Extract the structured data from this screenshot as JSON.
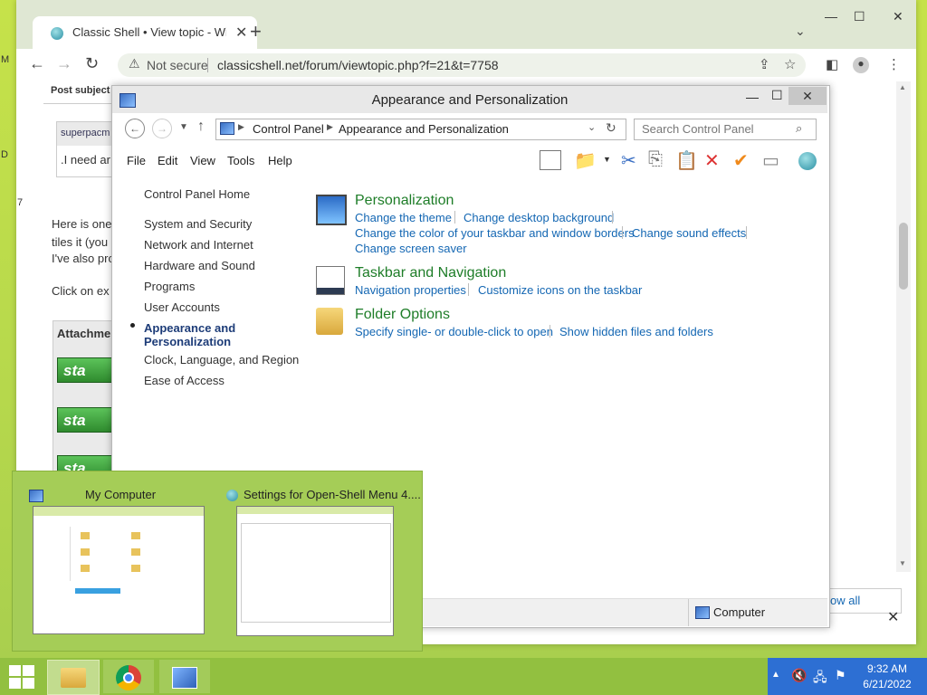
{
  "browser": {
    "tab_title": "Classic Shell • View topic - Windo",
    "new_tab": "+",
    "close_tab": "✕",
    "not_secure": "Not secure",
    "url": "classicshell.net/forum/viewtopic.php?f=21&t=7758"
  },
  "forum": {
    "post_subject": "Post subject",
    "user": "superpacm",
    "quote": ".I need ar",
    "line1": "Here is one",
    "line2": "tiles it (you",
    "line3": "I've also pro",
    "line4": "Click on ex",
    "attachments": "Attachme",
    "start_text": "sta",
    "num": "7",
    "left_m": "M",
    "left_d": "D",
    "show_all": "ow all"
  },
  "control_panel": {
    "title": "Appearance and Personalization",
    "breadcrumb": [
      "Control Panel",
      "Appearance and Personalization"
    ],
    "search_placeholder": "Search Control Panel",
    "menu": [
      "File",
      "Edit",
      "View",
      "Tools",
      "Help"
    ],
    "left_nav": {
      "home": "Control Panel Home",
      "items": [
        "System and Security",
        "Network and Internet",
        "Hardware and Sound",
        "Programs",
        "User Accounts"
      ],
      "current_line1": "Appearance and",
      "current_line2": "Personalization",
      "items2": [
        "Clock, Language, and Region",
        "Ease of Access"
      ]
    },
    "categories": {
      "personalization": {
        "title": "Personalization",
        "links": [
          "Change the theme",
          "Change desktop background",
          "Change the color of your taskbar and window borders",
          "Change sound effects",
          "Change screen saver"
        ]
      },
      "taskbar": {
        "title": "Taskbar and Navigation",
        "links": [
          "Navigation properties",
          "Customize icons on the taskbar"
        ]
      },
      "folder": {
        "title": "Folder Options",
        "links": [
          "Specify single- or double-click to open",
          "Show hidden files and folders"
        ]
      }
    },
    "status_computer": "Computer"
  },
  "thumbnails": {
    "my_computer": "My Computer",
    "settings": "Settings for Open-Shell Menu 4...."
  },
  "taskbar": {
    "time": "9:32 AM",
    "date": "6/21/2022"
  }
}
